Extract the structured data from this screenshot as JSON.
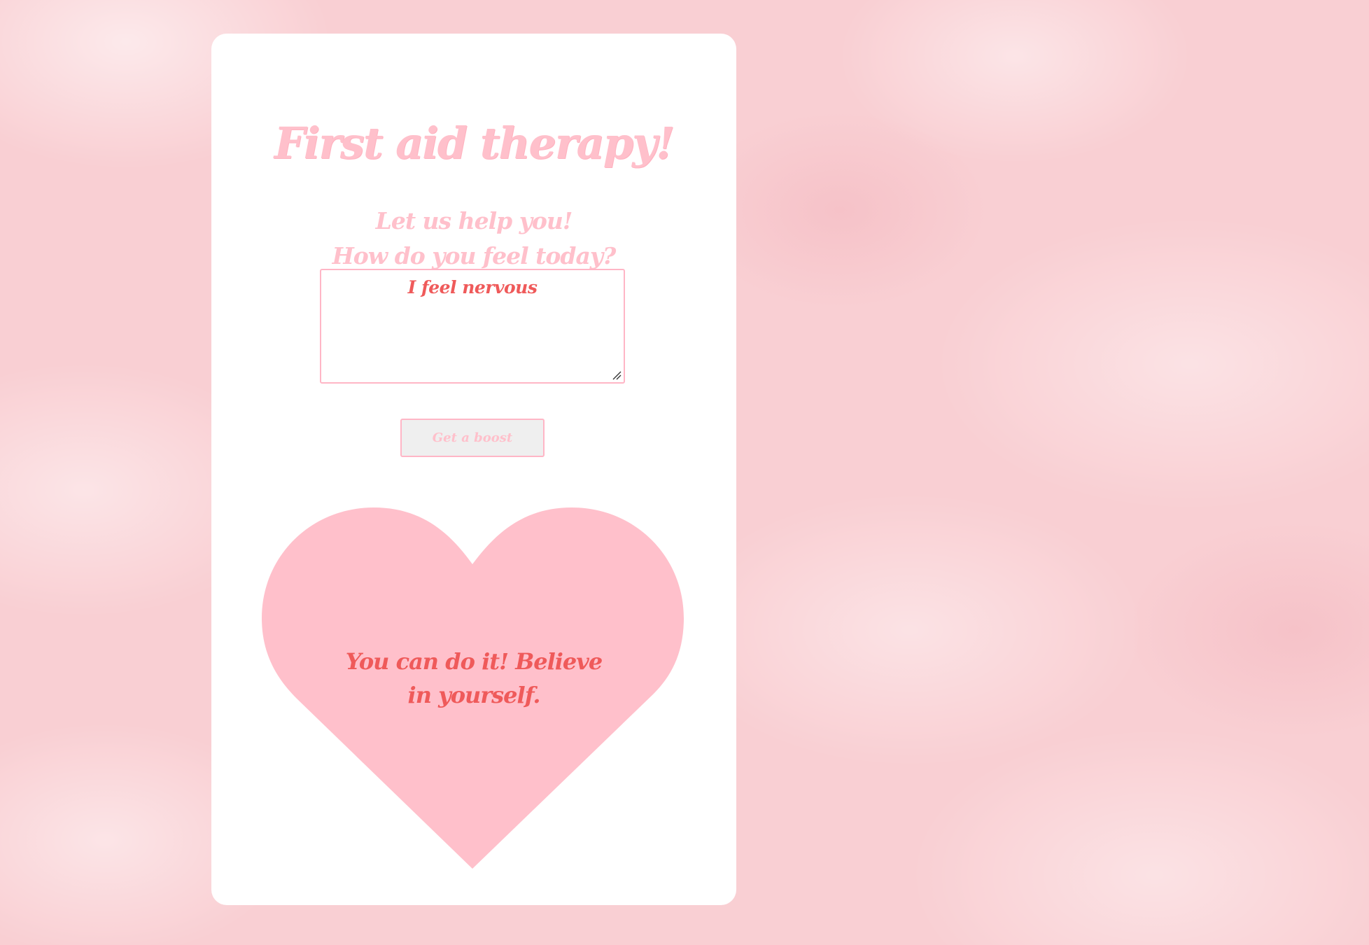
{
  "header": {
    "title": "First aid therapy!",
    "subtitle_line1": "Let us help you!",
    "subtitle_line2": "How do you feel today?"
  },
  "feelings_input": {
    "value": "I feel nervous"
  },
  "boost_button": {
    "label": "Get a boost"
  },
  "message": {
    "line1": "You can do it! Believe",
    "line2": "in yourself."
  },
  "colors": {
    "accent_pink": "#ffc0cb",
    "text_red": "#ef5a5a",
    "card_background": "#ffffff",
    "page_background": "#f9cfd3"
  },
  "icons": {
    "resize_handle": "resize-handle-icon",
    "heart": "heart-shape"
  }
}
